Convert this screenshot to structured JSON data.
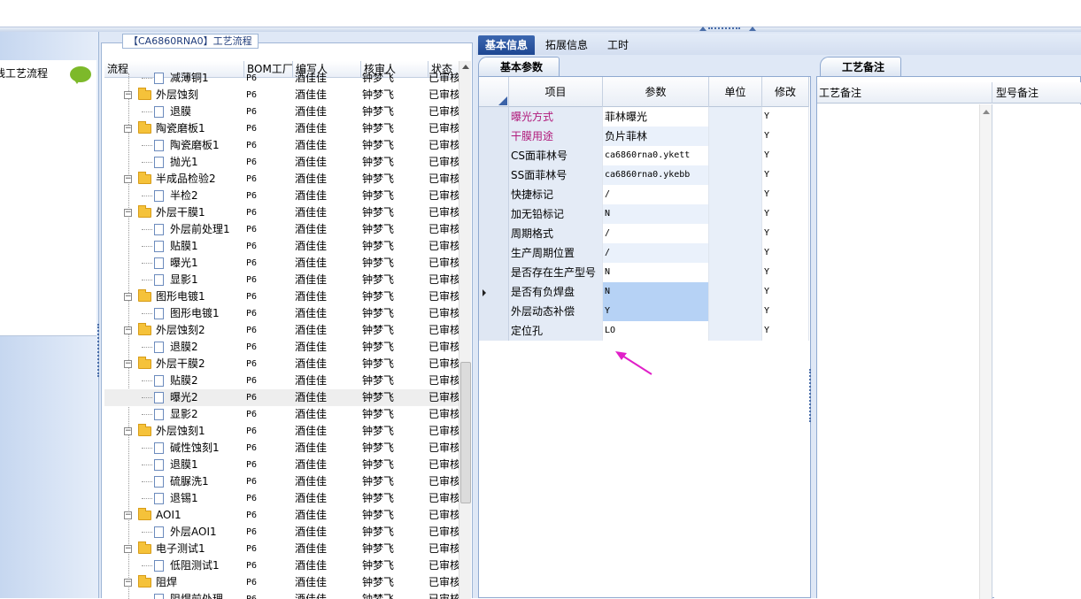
{
  "nav": {
    "item_label": "残工艺流程"
  },
  "tree": {
    "group_title": "【CA6860RNA0】工艺流程",
    "columns": [
      "流程",
      "BOM工厂",
      "编写人",
      "核审人",
      "状态"
    ],
    "rows": [
      {
        "level": 2,
        "name": "减薄铜1",
        "bom": "P6",
        "writer": "酒佳佳",
        "reviewer": "钟梦飞",
        "status": "已审核"
      },
      {
        "level": 1,
        "name": "外层蚀刻",
        "bom": "P6",
        "writer": "酒佳佳",
        "reviewer": "钟梦飞",
        "status": "已审核"
      },
      {
        "level": 2,
        "name": "退膜",
        "bom": "P6",
        "writer": "酒佳佳",
        "reviewer": "钟梦飞",
        "status": "已审核"
      },
      {
        "level": 1,
        "name": "陶瓷磨板1",
        "bom": "P6",
        "writer": "酒佳佳",
        "reviewer": "钟梦飞",
        "status": "已审核"
      },
      {
        "level": 2,
        "name": "陶瓷磨板1",
        "bom": "P6",
        "writer": "酒佳佳",
        "reviewer": "钟梦飞",
        "status": "已审核"
      },
      {
        "level": 2,
        "name": "抛光1",
        "bom": "P6",
        "writer": "酒佳佳",
        "reviewer": "钟梦飞",
        "status": "已审核"
      },
      {
        "level": 1,
        "name": "半成品检验2",
        "bom": "P6",
        "writer": "酒佳佳",
        "reviewer": "钟梦飞",
        "status": "已审核"
      },
      {
        "level": 2,
        "name": "半检2",
        "bom": "P6",
        "writer": "酒佳佳",
        "reviewer": "钟梦飞",
        "status": "已审核"
      },
      {
        "level": 1,
        "name": "外层干膜1",
        "bom": "P6",
        "writer": "酒佳佳",
        "reviewer": "钟梦飞",
        "status": "已审核"
      },
      {
        "level": 2,
        "name": "外层前处理1",
        "bom": "P6",
        "writer": "酒佳佳",
        "reviewer": "钟梦飞",
        "status": "已审核"
      },
      {
        "level": 2,
        "name": "贴膜1",
        "bom": "P6",
        "writer": "酒佳佳",
        "reviewer": "钟梦飞",
        "status": "已审核"
      },
      {
        "level": 2,
        "name": "曝光1",
        "bom": "P6",
        "writer": "酒佳佳",
        "reviewer": "钟梦飞",
        "status": "已审核"
      },
      {
        "level": 2,
        "name": "显影1",
        "bom": "P6",
        "writer": "酒佳佳",
        "reviewer": "钟梦飞",
        "status": "已审核"
      },
      {
        "level": 1,
        "name": "图形电镀1",
        "bom": "P6",
        "writer": "酒佳佳",
        "reviewer": "钟梦飞",
        "status": "已审核"
      },
      {
        "level": 2,
        "name": "图形电镀1",
        "bom": "P6",
        "writer": "酒佳佳",
        "reviewer": "钟梦飞",
        "status": "已审核"
      },
      {
        "level": 1,
        "name": "外层蚀刻2",
        "bom": "P6",
        "writer": "酒佳佳",
        "reviewer": "钟梦飞",
        "status": "已审核"
      },
      {
        "level": 2,
        "name": "退膜2",
        "bom": "P6",
        "writer": "酒佳佳",
        "reviewer": "钟梦飞",
        "status": "已审核"
      },
      {
        "level": 1,
        "name": "外层干膜2",
        "bom": "P6",
        "writer": "酒佳佳",
        "reviewer": "钟梦飞",
        "status": "已审核"
      },
      {
        "level": 2,
        "name": "贴膜2",
        "bom": "P6",
        "writer": "酒佳佳",
        "reviewer": "钟梦飞",
        "status": "已审核"
      },
      {
        "level": 2,
        "name": "曝光2",
        "bom": "P6",
        "writer": "酒佳佳",
        "reviewer": "钟梦飞",
        "status": "已审核",
        "selected": true
      },
      {
        "level": 2,
        "name": "显影2",
        "bom": "P6",
        "writer": "酒佳佳",
        "reviewer": "钟梦飞",
        "status": "已审核"
      },
      {
        "level": 1,
        "name": "外层蚀刻1",
        "bom": "P6",
        "writer": "酒佳佳",
        "reviewer": "钟梦飞",
        "status": "已审核"
      },
      {
        "level": 2,
        "name": "碱性蚀刻1",
        "bom": "P6",
        "writer": "酒佳佳",
        "reviewer": "钟梦飞",
        "status": "已审核"
      },
      {
        "level": 2,
        "name": "退膜1",
        "bom": "P6",
        "writer": "酒佳佳",
        "reviewer": "钟梦飞",
        "status": "已审核"
      },
      {
        "level": 2,
        "name": "硫脲洗1",
        "bom": "P6",
        "writer": "酒佳佳",
        "reviewer": "钟梦飞",
        "status": "已审核"
      },
      {
        "level": 2,
        "name": "退锡1",
        "bom": "P6",
        "writer": "酒佳佳",
        "reviewer": "钟梦飞",
        "status": "已审核"
      },
      {
        "level": 1,
        "name": "AOI1",
        "bom": "P6",
        "writer": "酒佳佳",
        "reviewer": "钟梦飞",
        "status": "已审核"
      },
      {
        "level": 2,
        "name": "外层AOI1",
        "bom": "P6",
        "writer": "酒佳佳",
        "reviewer": "钟梦飞",
        "status": "已审核"
      },
      {
        "level": 1,
        "name": "电子测试1",
        "bom": "P6",
        "writer": "酒佳佳",
        "reviewer": "钟梦飞",
        "status": "已审核"
      },
      {
        "level": 2,
        "name": "低阻测试1",
        "bom": "P6",
        "writer": "酒佳佳",
        "reviewer": "钟梦飞",
        "status": "已审核"
      },
      {
        "level": 1,
        "name": "阻焊",
        "bom": "P6",
        "writer": "酒佳佳",
        "reviewer": "钟梦飞",
        "status": "已审核"
      },
      {
        "level": 2,
        "name": "阻焊前处理",
        "bom": "P6",
        "writer": "酒佳佳",
        "reviewer": "钟梦飞",
        "status": "已审核"
      }
    ]
  },
  "tabs": [
    "基本信息",
    "拓展信息",
    "工时"
  ],
  "params": {
    "subtab": "基本参数",
    "columns": [
      "项目",
      "参数",
      "单位",
      "修改"
    ],
    "rows": [
      {
        "item": "曝光方式",
        "value": "菲林曝光",
        "unit": "",
        "mod": "Y",
        "pink": true
      },
      {
        "item": "干膜用途",
        "value": "负片菲林",
        "unit": "",
        "mod": "Y",
        "pink": true
      },
      {
        "item": "CS面菲林号",
        "value": "ca6860rna0.ykett",
        "unit": "",
        "mod": "Y",
        "mono": true
      },
      {
        "item": "SS面菲林号",
        "value": "ca6860rna0.ykebb",
        "unit": "",
        "mod": "Y",
        "mono": true
      },
      {
        "item": "快捷标记",
        "value": "/",
        "unit": "",
        "mod": "Y",
        "mono": true
      },
      {
        "item": "加无铅标记",
        "value": "N",
        "unit": "",
        "mod": "Y",
        "mono": true
      },
      {
        "item": "周期格式",
        "value": "/",
        "unit": "",
        "mod": "Y",
        "mono": true
      },
      {
        "item": "生产周期位置",
        "value": "/",
        "unit": "",
        "mod": "Y",
        "mono": true
      },
      {
        "item": "是否存在生产型号",
        "value": "N",
        "unit": "",
        "mod": "Y",
        "mono": true
      },
      {
        "item": "是否有负焊盘",
        "value": "N",
        "unit": "",
        "mod": "Y",
        "mono": true,
        "current": true
      },
      {
        "item": "外层动态补偿",
        "value": "Y",
        "unit": "",
        "mod": "Y",
        "mono": true
      },
      {
        "item": "定位孔",
        "value": "LO",
        "unit": "",
        "mod": "Y",
        "mono": true
      }
    ]
  },
  "remarks": {
    "subtab": "工艺备注",
    "columns": [
      "工艺备注",
      "型号备注"
    ]
  },
  "colors": {
    "accent": "#1e4792",
    "pink": "#b0187a",
    "arrow": "#e020c8"
  }
}
